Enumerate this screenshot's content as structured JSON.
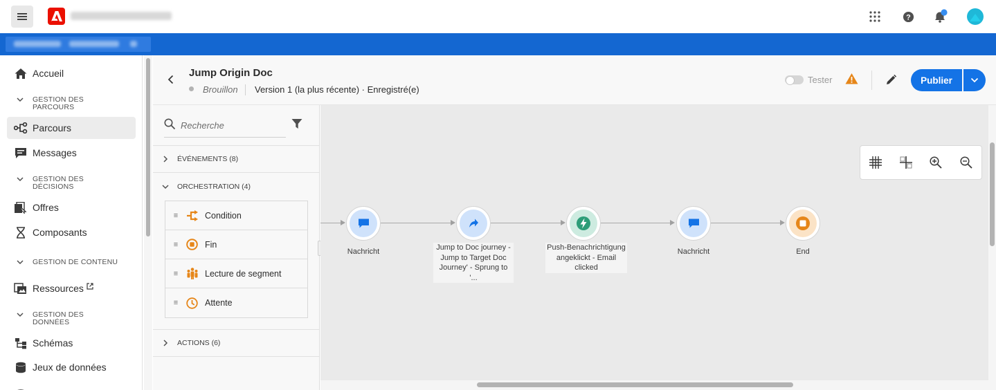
{
  "topbar": {
    "menu_icon": "hamburger-icon",
    "logo_icon": "adobe-logo",
    "icons": [
      "apps-grid-icon",
      "help-icon",
      "bell-icon",
      "avatar"
    ]
  },
  "sidebar": {
    "items": [
      {
        "label": "Accueil",
        "icon": "home-icon"
      },
      {
        "label": "GESTION DES PARCOURS",
        "type": "section"
      },
      {
        "label": "Parcours",
        "icon": "journey-icon",
        "active": true
      },
      {
        "label": "Messages",
        "icon": "message-icon"
      },
      {
        "label": "GESTION DES DÉCISIONS",
        "type": "section"
      },
      {
        "label": "Offres",
        "icon": "offers-icon"
      },
      {
        "label": "Composants",
        "icon": "components-icon"
      },
      {
        "label": "GESTION DE CONTENU",
        "type": "section"
      },
      {
        "label": "Ressources",
        "icon": "assets-icon",
        "external": true
      },
      {
        "label": "GESTION DES DONNÉES",
        "type": "section"
      },
      {
        "label": "Schémas",
        "icon": "schema-icon"
      },
      {
        "label": "Jeux de données",
        "icon": "datasets-icon"
      }
    ],
    "section_lines": {
      "parcours": [
        "GESTION DES",
        "PARCOURS"
      ],
      "decisions": [
        "GESTION DES",
        "DÉCISIONS"
      ],
      "contenu": [
        "GESTION DE CONTENU"
      ],
      "donnees": [
        "GESTION DES",
        "DONNÉES"
      ]
    }
  },
  "journey": {
    "title": "Jump Origin Doc",
    "status": "Brouillon",
    "version": "Version 1 (la plus récente) · Enregistré(e)",
    "tester_label": "Tester",
    "publish_label": "Publier"
  },
  "palette": {
    "search_placeholder": "Recherche",
    "categories": {
      "events": "ÉVÉNEMENTS (8)",
      "orchestration": "ORCHESTRATION (4)",
      "actions": "ACTIONS (6)"
    },
    "orchestration_items": [
      {
        "label": "Condition",
        "icon": "condition-icon"
      },
      {
        "label": "Fin",
        "icon": "end-icon"
      },
      {
        "label": "Lecture de segment",
        "icon": "segment-icon"
      },
      {
        "label": "Attente",
        "icon": "wait-icon"
      }
    ]
  },
  "canvas": {
    "toolbar": [
      "grid-icon",
      "align-icon",
      "zoom-in-icon",
      "zoom-out-icon"
    ],
    "nodes": [
      {
        "label": "Nachricht",
        "icon": "message-bubble-icon",
        "color": "#1473e6",
        "bg": "#cfe2fb"
      },
      {
        "label": "Jump to Doc journey - Jump to Target Doc Journey' - Sprung to '...",
        "icon": "jump-arrow-icon",
        "color": "#1473e6",
        "bg": "#cfe2fb"
      },
      {
        "label": "Push-Benachrichtigung angeklickt - Email clicked",
        "icon": "event-bolt-icon",
        "color": "#2d9d78",
        "bg": "#cdebe0"
      },
      {
        "label": "Nachricht",
        "icon": "message-bubble-icon",
        "color": "#1473e6",
        "bg": "#cfe2fb"
      },
      {
        "label": "End",
        "icon": "end-stop-icon",
        "color": "#e68619",
        "bg": "#fbe3c6"
      }
    ],
    "node_label_lines": {
      "n1": [
        "Nachricht"
      ],
      "n2": [
        "Jump to Doc journey -",
        "Jump to Target Doc",
        "Journey' - Sprung to '..."
      ],
      "n3": [
        "Push-Benachrichtigung",
        "angeklickt - Email",
        "clicked"
      ],
      "n4": [
        "Nachricht"
      ],
      "n5": [
        "End"
      ]
    }
  },
  "colors": {
    "brand_blue": "#1467d1",
    "button_blue": "#1473e6",
    "adobe_red": "#eb1000",
    "warning": "#e68619"
  }
}
